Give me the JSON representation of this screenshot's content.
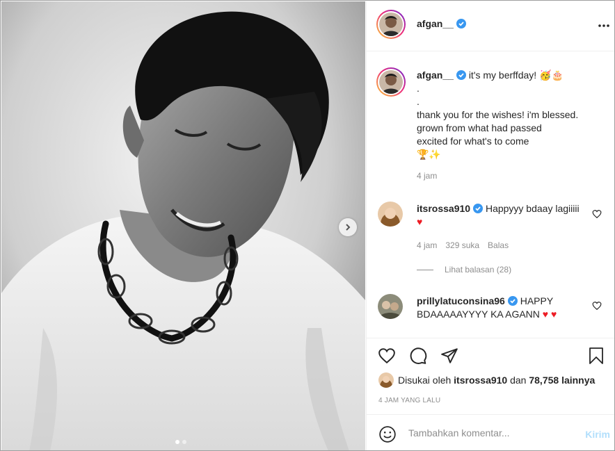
{
  "post": {
    "username": "afgan__",
    "image_alt": "black and white portrait photo",
    "carousel": {
      "active_index": 0,
      "count": 2
    }
  },
  "caption": {
    "username": "afgan__",
    "first_line": "it's my berffday!",
    "first_line_emojis": "🥳🎂",
    "lines": [
      ".",
      ".",
      "thank you for the wishes! i'm blessed.",
      "grown from what had passed",
      "excited for what's to come"
    ],
    "trailing_emojis": "🏆✨",
    "time": "4 jam"
  },
  "comments": [
    {
      "username": "itsrossa910",
      "text": "Happyyy bdaay lagiiiii",
      "emoji": "♥",
      "time": "4 jam",
      "likes": "329 suka",
      "reply_label": "Balas",
      "view_replies": "Lihat balasan (28)"
    },
    {
      "username": "prillylatuconsina96",
      "text": "HAPPY BDAAAAAYYYY KA AGANN",
      "emoji": "♥ ♥"
    }
  ],
  "likes": {
    "prefix": "Disukai oleh",
    "user": "itsrossa910",
    "connector": "dan",
    "others": "78,758 lainnya"
  },
  "time_ago": "4 JAM YANG LALU",
  "comment_box": {
    "placeholder": "Tambahkan komentar...",
    "post_label": "Kirim"
  },
  "colors": {
    "verified": "#3897f0",
    "heart_emoji": "#ed1c24",
    "post_disabled": "#b2dffc"
  }
}
